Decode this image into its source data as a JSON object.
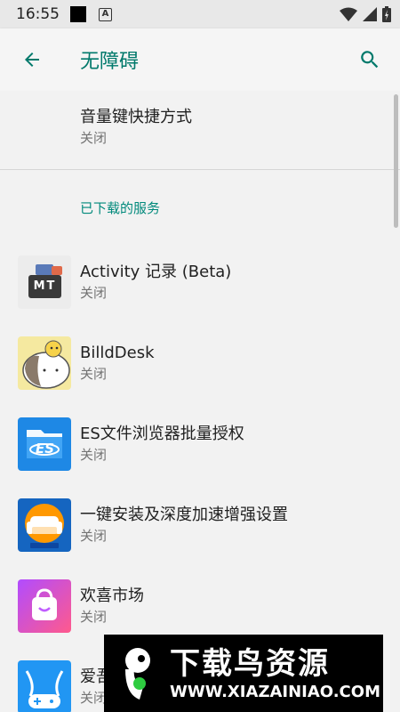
{
  "status_bar": {
    "time": "16:55",
    "notif_letter": "A"
  },
  "app_bar": {
    "title": "无障碍"
  },
  "volume_shortcut": {
    "title": "音量键快捷方式",
    "status": "关闭"
  },
  "section": {
    "header": "已下载的服务"
  },
  "services": [
    {
      "name": "Activity 记录 (Beta)",
      "status": "关闭",
      "icon": "mt-manager-icon",
      "icon_text": "MT"
    },
    {
      "name": "BilldDesk",
      "status": "关闭",
      "icon": "billddesk-icon"
    },
    {
      "name": "ES文件浏览器批量授权",
      "status": "关闭",
      "icon": "es-file-explorer-icon",
      "icon_text": "ES"
    },
    {
      "name": "一键安装及深度加速增强设置",
      "status": "关闭",
      "icon": "sofa-icon"
    },
    {
      "name": "欢喜市场",
      "status": "关闭",
      "icon": "shopping-bag-icon"
    },
    {
      "name": "爱吾",
      "status": "关闭",
      "icon": "gamepad-icon"
    }
  ],
  "watermark": {
    "title": "下载鸟资源",
    "url": "WWW.XIAZAINIAO.COM"
  },
  "colors": {
    "accent": "#00796b",
    "section_header": "#00897b",
    "background": "#f2f2f2"
  }
}
